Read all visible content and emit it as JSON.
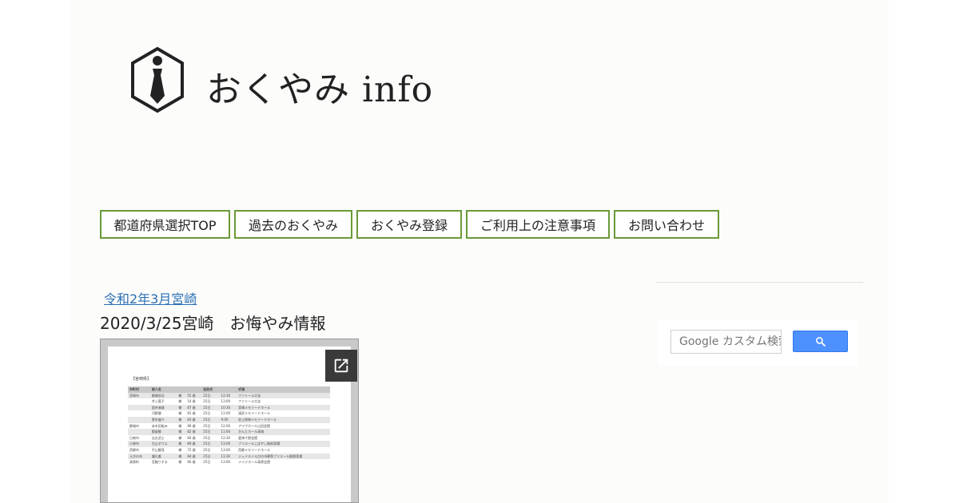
{
  "header": {
    "site_title": "おくやみ info",
    "logo_icon": "tie-hexagon-logo"
  },
  "nav": {
    "items": [
      {
        "label": "都道府県選択TOP"
      },
      {
        "label": "過去のおくやみ"
      },
      {
        "label": "おくやみ登録"
      },
      {
        "label": "ご利用上の注意事項"
      },
      {
        "label": "お問い合わせ"
      }
    ],
    "border_color": "#6a9a3a"
  },
  "post": {
    "category_link": "令和2年3月宮崎",
    "title": "2020/3/25宮崎　お悔やみ情報",
    "open_icon": "open-in-new-icon",
    "document": {
      "heading": "【宮崎県】",
      "columns": [
        "市町村",
        "故人名",
        "",
        "",
        "告別式",
        "",
        "式場"
      ],
      "rows": [
        [
          "宮崎市",
          "都城信次",
          "様",
          "55 歳",
          "25日",
          "12:30",
          "ファミーユ大淀"
        ],
        [
          "",
          "井上蓉子",
          "様",
          "54 歳",
          "25日",
          "13:00",
          "ファミーユ大淀"
        ],
        [
          "",
          "園井遙雄",
          "様",
          "87 歳",
          "25日",
          "10:30",
          "宮崎メモリードホール"
        ],
        [
          "",
          "河野健",
          "様",
          "81 歳",
          "25日",
          "11:00",
          "清武メモリードホール"
        ],
        [
          "",
          "黒木盛介",
          "様",
          "83 歳",
          "25日",
          "9:00",
          "佐土原典メモリードホール"
        ],
        [
          "都城市",
          "赤木田紘み",
          "様",
          "89 歳",
          "25日",
          "12:00",
          "アイワホール山田会館"
        ],
        [
          "",
          "都留勝",
          "様",
          "82 歳",
          "25日",
          "11:00",
          "かんとホール高城"
        ],
        [
          "日南市",
          "吉丸武士",
          "様",
          "84 歳",
          "25日",
          "12:30",
          "愛南千野会館"
        ],
        [
          "小林市",
          "古山すりエ",
          "様",
          "89 歳",
          "25日",
          "13:00",
          "ブリエールこばやし駅前斎場"
        ],
        [
          "西都市",
          "平山勝見",
          "様",
          "72 歳",
          "25日",
          "13:00",
          "西都メモリードホール"
        ],
        [
          "えびの市",
          "瀧久美",
          "様",
          "84 歳",
          "25日",
          "11:30",
          "ジェイエイえびの市葬祭ブリエール飯野斎場"
        ],
        [
          "高原町",
          "宮脇りずる",
          "様",
          "66 歳",
          "25日",
          "13:00",
          "メイジホール高原会館"
        ]
      ]
    }
  },
  "sidebar": {
    "search_placeholder": "Google カスタム検索",
    "search_icon": "search-icon",
    "button_color": "#4d90fe"
  }
}
